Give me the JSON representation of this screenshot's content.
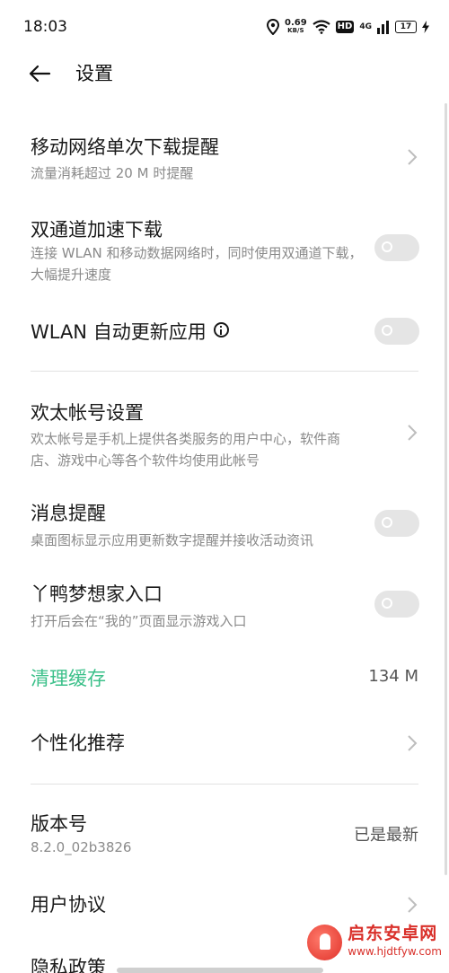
{
  "status_bar": {
    "time": "18:03",
    "speed_value": "0.69",
    "speed_unit": "KB/S",
    "hd_label": "HD",
    "network_label": "4G",
    "battery_level": "17"
  },
  "header": {
    "title": "设置"
  },
  "settings": {
    "mobile_download_alert": {
      "title": "移动网络单次下载提醒",
      "subtitle": "流量消耗超过 20 M 时提醒"
    },
    "dual_channel": {
      "title": "双通道加速下载",
      "subtitle": "连接 WLAN 和移动数据网络时，同时使用双通道下载，大幅提升速度",
      "enabled": false
    },
    "wlan_auto_update": {
      "title": "WLAN 自动更新应用",
      "enabled": false
    },
    "account": {
      "title": "欢太帐号设置",
      "subtitle": "欢太帐号是手机上提供各类服务的用户中心，软件商店、游戏中心等各个软件均使用此帐号"
    },
    "notifications": {
      "title": "消息提醒",
      "subtitle": "桌面图标显示应用更新数字提醒并接收活动资讯",
      "enabled": false
    },
    "yaya_entry": {
      "title": "丫鸭梦想家入口",
      "subtitle": "打开后会在“我的”页面显示游戏入口",
      "enabled": false
    },
    "clear_cache": {
      "title": "清理缓存",
      "value": "134 M",
      "accent_color": "#3cc08a"
    },
    "personalized": {
      "title": "个性化推荐"
    },
    "version": {
      "title": "版本号",
      "subtitle": "8.2.0_02b3826",
      "value": "已是最新"
    },
    "user_agreement": {
      "title": "用户协议"
    },
    "privacy": {
      "title": "隐私政策"
    }
  },
  "watermark": {
    "name": "启东安卓网",
    "url": "www.hjdtfyw.com"
  }
}
